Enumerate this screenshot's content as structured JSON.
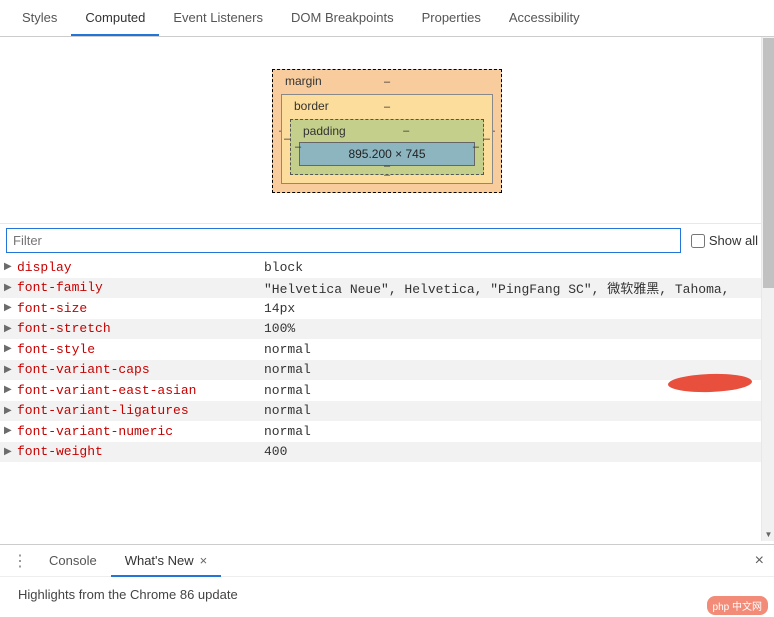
{
  "tabs": {
    "t0": "Styles",
    "t1": "Computed",
    "t2": "Event Listeners",
    "t3": "DOM Breakpoints",
    "t4": "Properties",
    "t5": "Accessibility"
  },
  "boxModel": {
    "marginLabel": "margin",
    "borderLabel": "border",
    "paddingLabel": "padding",
    "dash": "–",
    "content": "895.200 × 745"
  },
  "filter": {
    "placeholder": "Filter",
    "showAll": "Show all"
  },
  "props": [
    {
      "name": "display",
      "value": "block"
    },
    {
      "name": "font-family",
      "value": "\"Helvetica Neue\", Helvetica, \"PingFang SC\", 微软雅黑, Tahoma,"
    },
    {
      "name": "font-size",
      "value": "14px"
    },
    {
      "name": "font-stretch",
      "value": "100%"
    },
    {
      "name": "font-style",
      "value": "normal"
    },
    {
      "name": "font-variant-caps",
      "value": "normal"
    },
    {
      "name": "font-variant-east-asian",
      "value": "normal"
    },
    {
      "name": "font-variant-ligatures",
      "value": "normal"
    },
    {
      "name": "font-variant-numeric",
      "value": "normal"
    },
    {
      "name": "font-weight",
      "value": "400"
    }
  ],
  "drawer": {
    "console": "Console",
    "whatsNew": "What's New",
    "highlight": "Highlights from the Chrome 86 update"
  },
  "watermark": "php 中文网"
}
